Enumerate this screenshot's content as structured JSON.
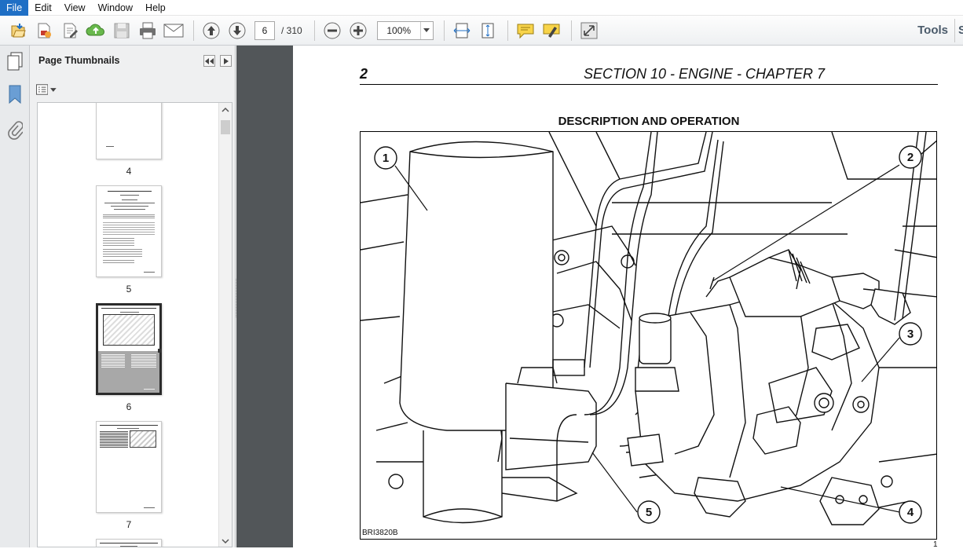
{
  "menu": {
    "items": [
      "File",
      "Edit",
      "View",
      "Window",
      "Help"
    ]
  },
  "toolbar": {
    "page_current": "6",
    "page_total": "/ 310",
    "zoom": "100%",
    "tools_label": "Tools",
    "icons": [
      "open-icon",
      "create-icon",
      "edit-icon",
      "upload-icon",
      "save-icon",
      "print-icon",
      "email-icon",
      "page-up-icon",
      "page-down-icon",
      "zoom-out-icon",
      "zoom-in-icon",
      "fit-width-icon",
      "fit-page-icon",
      "comment-icon",
      "highlight-icon",
      "fullscreen-icon"
    ]
  },
  "sidebar": {
    "title": "Page Thumbnails",
    "thumbnails": [
      {
        "label": "4"
      },
      {
        "label": "5"
      },
      {
        "label": "6",
        "selected": true
      },
      {
        "label": "7"
      }
    ]
  },
  "document": {
    "page_number": "2",
    "header_title": "SECTION 10 - ENGINE - CHAPTER 7",
    "section_heading": "DESCRIPTION AND OPERATION",
    "figure_code": "BRI3820B",
    "callouts": [
      "1",
      "2",
      "3",
      "4",
      "5"
    ],
    "corner_number": "1"
  },
  "colors": {
    "menu_active": "#1f6fc5",
    "doc_background": "#525659",
    "panel_background": "#eff0f1"
  }
}
